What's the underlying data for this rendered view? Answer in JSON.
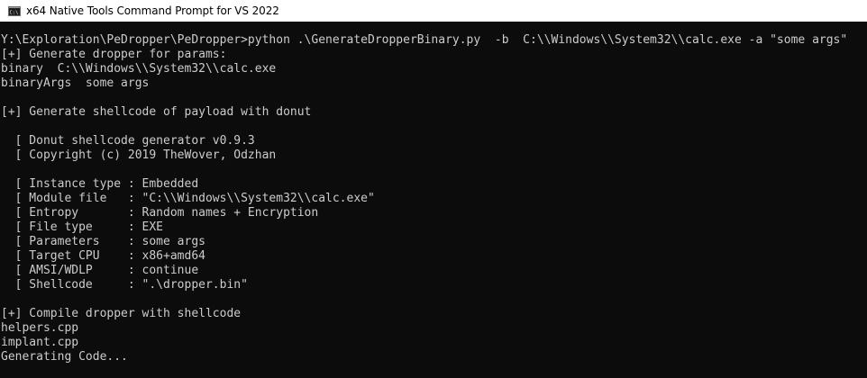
{
  "window": {
    "title": "x64 Native Tools Command Prompt for VS 2022",
    "icon": "command-prompt-icon"
  },
  "colors": {
    "background": "#0c0c0c",
    "text": "#cccccc",
    "titlebar": "#ffffff"
  },
  "console": {
    "lines": [
      "Y:\\Exploration\\PeDropper\\PeDropper>python .\\GenerateDropperBinary.py  -b  C:\\\\Windows\\\\System32\\\\calc.exe -a \"some args\"",
      "[+] Generate dropper for params:",
      "binary  C:\\\\Windows\\\\System32\\\\calc.exe",
      "binaryArgs  some args",
      "",
      "[+] Generate shellcode of payload with donut",
      "",
      "  [ Donut shellcode generator v0.9.3",
      "  [ Copyright (c) 2019 TheWover, Odzhan",
      "",
      "  [ Instance type : Embedded",
      "  [ Module file   : \"C:\\\\Windows\\\\System32\\\\calc.exe\"",
      "  [ Entropy       : Random names + Encryption",
      "  [ File type     : EXE",
      "  [ Parameters    : some args",
      "  [ Target CPU    : x86+amd64",
      "  [ AMSI/WDLP     : continue",
      "  [ Shellcode     : \".\\dropper.bin\"",
      "",
      "[+] Compile dropper with shellcode",
      "helpers.cpp",
      "implant.cpp",
      "Generating Code..."
    ]
  }
}
